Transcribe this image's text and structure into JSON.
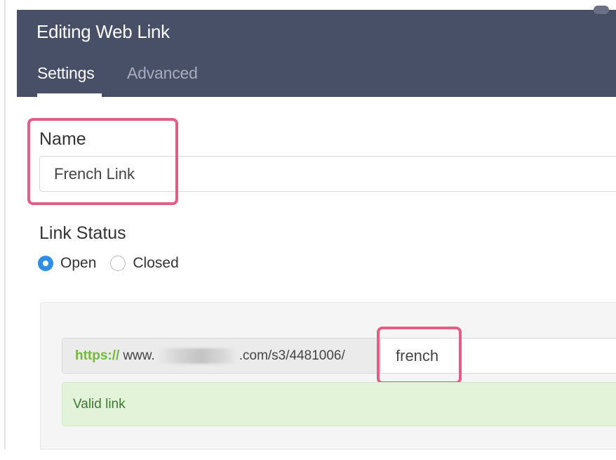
{
  "header": {
    "title": "Editing Web Link",
    "tabs": [
      {
        "label": "Settings",
        "active": true
      },
      {
        "label": "Advanced",
        "active": false
      }
    ]
  },
  "name_field": {
    "label": "Name",
    "value": "French Link"
  },
  "link_status": {
    "label": "Link Status",
    "options": [
      {
        "label": "Open",
        "selected": true
      },
      {
        "label": "Closed",
        "selected": false
      }
    ]
  },
  "url": {
    "protocol": "https://",
    "host_start": "www.",
    "path": ".com/s3/4481006/",
    "slug": "french"
  },
  "validation": {
    "message": "Valid link"
  },
  "colors": {
    "header_bg": "#485068",
    "highlight": "#e05f84",
    "radio_selected": "#2f8ee6",
    "protocol_text": "#74b83c",
    "valid_bg": "#e3f3da",
    "valid_text": "#3c7a32"
  }
}
